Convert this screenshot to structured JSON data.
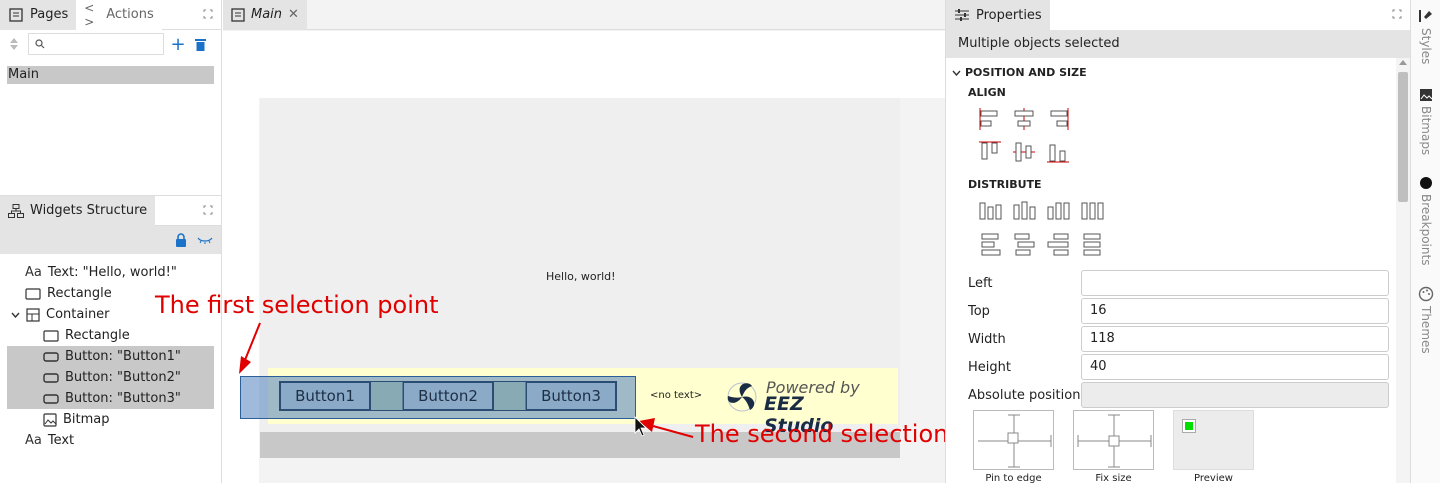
{
  "pages_panel": {
    "tab_pages": "Pages",
    "tab_actions": "Actions",
    "search_placeholder": "",
    "items": [
      "Main"
    ]
  },
  "widgets_panel": {
    "title": "Widgets Structure",
    "items": [
      {
        "label": "Text: \"Hello, world!\"",
        "icon": "text-icon"
      },
      {
        "label": "Rectangle",
        "icon": "rectangle-icon"
      },
      {
        "label": "Container",
        "icon": "container-icon"
      },
      {
        "label": "Rectangle",
        "icon": "rectangle-icon"
      },
      {
        "label": "Button: \"Button1\"",
        "icon": "button-icon"
      },
      {
        "label": "Button: \"Button2\"",
        "icon": "button-icon"
      },
      {
        "label": "Button: \"Button3\"",
        "icon": "button-icon"
      },
      {
        "label": "Bitmap",
        "icon": "bitmap-icon"
      },
      {
        "label": "Text",
        "icon": "text-icon"
      }
    ]
  },
  "editor": {
    "tab_label": "Main",
    "hello_text": "Hello, world!",
    "button1": "Button1",
    "button2": "Button2",
    "button3": "Button3",
    "no_text": "<no text>",
    "logo_powered": "Powered by",
    "logo_studio": "EEZ Studio",
    "annotation_first": "The first selection point",
    "annotation_second": "The second selection point"
  },
  "properties": {
    "title": "Properties",
    "header": "Multiple objects selected",
    "section": "POSITION AND SIZE",
    "align": "ALIGN",
    "distribute": "DISTRIBUTE",
    "left_label": "Left",
    "left_value": "",
    "top_label": "Top",
    "top_value": "16",
    "width_label": "Width",
    "width_value": "118",
    "height_label": "Height",
    "height_value": "40",
    "abs_label": "Absolute position",
    "abs_value": "",
    "pin_label": "Pin to edge",
    "fix_label": "Fix size",
    "preview_label": "Preview"
  },
  "sidetabs": [
    "Styles",
    "Bitmaps",
    "Breakpoints",
    "Themes"
  ],
  "colors": {
    "selection": "#c8c8c8",
    "button_fill": "#8aaac8",
    "annotation": "#e00000",
    "preview_green": "#00e000"
  }
}
